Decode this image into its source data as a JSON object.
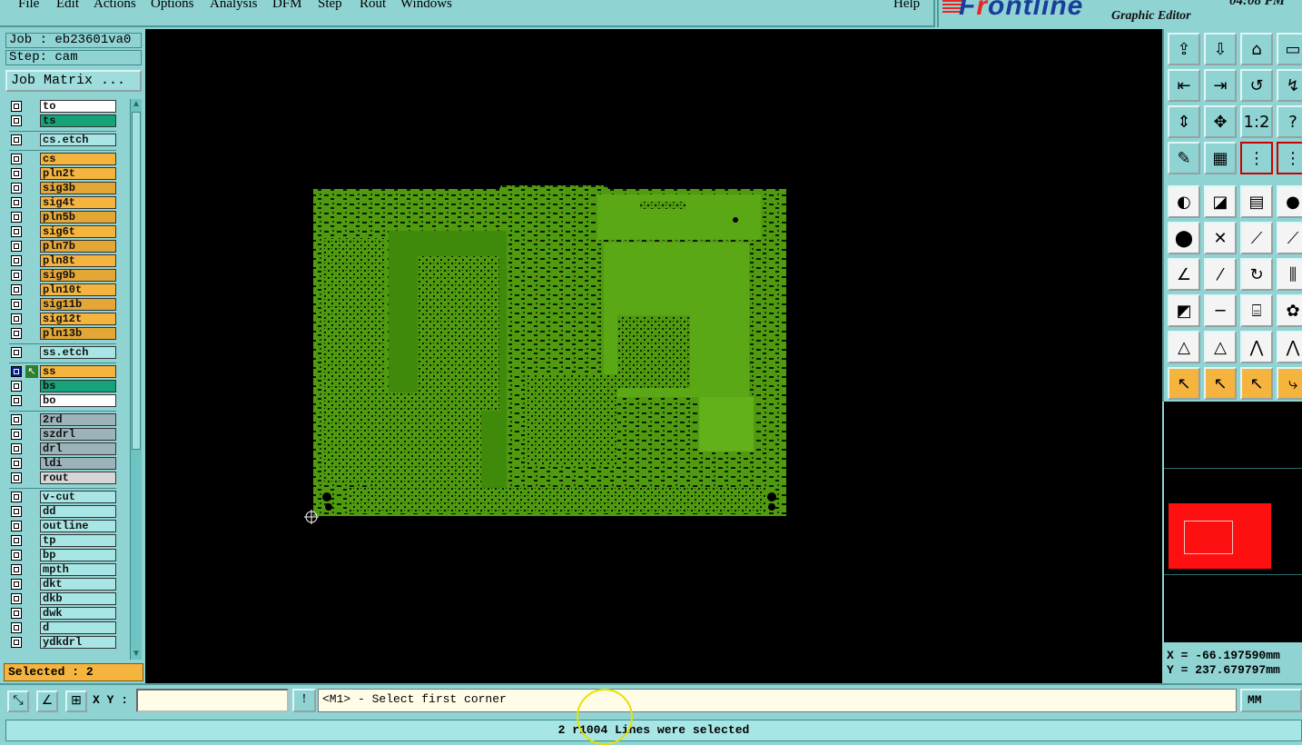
{
  "menu": {
    "items": [
      "File",
      "Edit",
      "Actions",
      "Options",
      "Analysis",
      "DFM",
      "Step",
      "Rout",
      "Windows"
    ],
    "help": "Help"
  },
  "brand": {
    "logo_pre": "F",
    "logo_mid": "r",
    "logo_post": "ontline",
    "subtitle": "Graphic Editor",
    "time": "04:08 PM"
  },
  "job": {
    "job_label": "Job : eb23601va0",
    "step_label": "Step: cam",
    "matrix_button": "Job Matrix ..."
  },
  "layers": [
    {
      "name": "to",
      "color": "#ffffff"
    },
    {
      "name": "ts",
      "color": "#16a37a"
    },
    {
      "sep": true
    },
    {
      "name": "cs.etch",
      "color": "#a8e6e6"
    },
    {
      "sep": true
    },
    {
      "name": "cs",
      "color": "#f5b43d"
    },
    {
      "name": "pln2t",
      "color": "#f5b43d"
    },
    {
      "name": "sig3b",
      "color": "#e4a736"
    },
    {
      "name": "sig4t",
      "color": "#f5b43d"
    },
    {
      "name": "pln5b",
      "color": "#e4a736"
    },
    {
      "name": "sig6t",
      "color": "#f5b43d"
    },
    {
      "name": "pln7b",
      "color": "#e4a736"
    },
    {
      "name": "pln8t",
      "color": "#f5b43d"
    },
    {
      "name": "sig9b",
      "color": "#e4a736"
    },
    {
      "name": "pln10t",
      "color": "#f5b43d"
    },
    {
      "name": "sig11b",
      "color": "#e4a736"
    },
    {
      "name": "sig12t",
      "color": "#f5b43d"
    },
    {
      "name": "pln13b",
      "color": "#e4a736"
    },
    {
      "sep": true
    },
    {
      "name": "ss.etch",
      "color": "#a8e6e6"
    },
    {
      "sep": true
    },
    {
      "name": "ss",
      "color": "#f5b43d",
      "affected": true,
      "work": true
    },
    {
      "name": "bs",
      "color": "#16a37a"
    },
    {
      "name": "bo",
      "color": "#ffffff"
    },
    {
      "sep": true
    },
    {
      "name": "2rd",
      "color": "#9bb3b9"
    },
    {
      "name": "szdrl",
      "color": "#9bb3b9"
    },
    {
      "name": "drl",
      "color": "#9bb3b9"
    },
    {
      "name": "ldi",
      "color": "#9bb3b9"
    },
    {
      "name": "rout",
      "color": "#d6d6d6"
    },
    {
      "sep": true
    },
    {
      "name": "v-cut",
      "color": "#a8e6e6"
    },
    {
      "name": "dd",
      "color": "#a8e6e6"
    },
    {
      "name": "outline",
      "color": "#a8e6e6"
    },
    {
      "name": "tp",
      "color": "#a8e6e6"
    },
    {
      "name": "bp",
      "color": "#a8e6e6"
    },
    {
      "name": "mpth",
      "color": "#a8e6e6"
    },
    {
      "name": "dkt",
      "color": "#a8e6e6"
    },
    {
      "name": "dkb",
      "color": "#a8e6e6"
    },
    {
      "name": "dwk",
      "color": "#a8e6e6"
    },
    {
      "name": "d",
      "color": "#a8e6e6"
    },
    {
      "name": "ydkdrl",
      "color": "#a8e6e6"
    }
  ],
  "selected_label": "Selected : 2",
  "coords": {
    "x": "X = -66.197590mm",
    "y": "Y = 237.679797mm"
  },
  "command": {
    "xy_label": "X Y :",
    "xy_value": "",
    "prompt": "<M1> - Select first corner",
    "units": "MM"
  },
  "status": "2 r1004 Lines were selected",
  "colors": {
    "panel": "#8fd3d3",
    "board": "#4f9a0f",
    "overview_frame": "#ff1010"
  }
}
